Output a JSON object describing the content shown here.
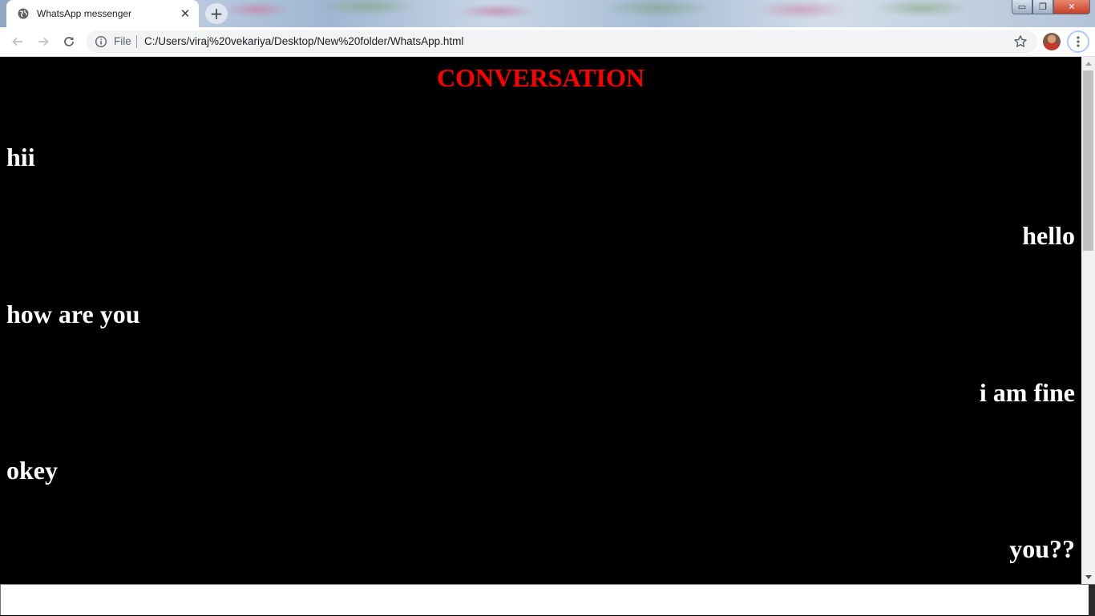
{
  "browser": {
    "tab_title": "WhatsApp messenger",
    "tab_close": "✕",
    "new_tab": "+",
    "window_controls": {
      "minimize": "▭",
      "maximize": "❐",
      "close": "✕"
    },
    "address": {
      "scheme_label": "File",
      "url": "C:/Users/viraj%20vekariya/Desktop/New%20folder/WhatsApp.html"
    },
    "icons": [
      "globe-icon",
      "back-arrow-icon",
      "forward-arrow-icon",
      "reload-icon",
      "info-icon",
      "star-icon",
      "kebab-menu-icon"
    ]
  },
  "page": {
    "heading": "CONVERSATION",
    "heading_color": "#ff0000",
    "background_color": "#000000",
    "text_color": "#ffffff",
    "messages": [
      {
        "text": "hii",
        "side": "left"
      },
      {
        "text": "hello",
        "side": "right"
      },
      {
        "text": "how are you",
        "side": "left"
      },
      {
        "text": "i am fine",
        "side": "right"
      },
      {
        "text": "okey",
        "side": "left"
      },
      {
        "text": "you??",
        "side": "right"
      }
    ]
  }
}
